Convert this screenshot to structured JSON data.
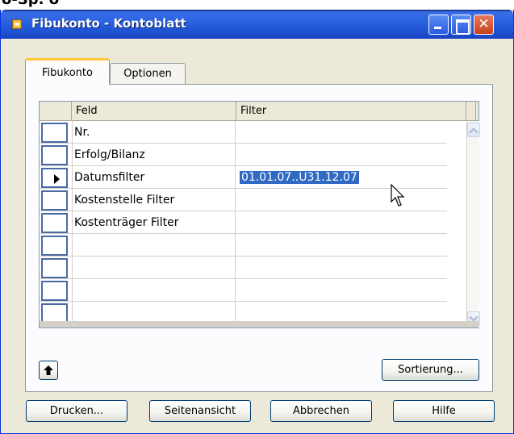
{
  "top_stub": "ö-Sp. ö",
  "window": {
    "title": "Fibukonto - Kontoblatt"
  },
  "tabs": [
    {
      "label": "Fibukonto",
      "active": true
    },
    {
      "label": "Optionen",
      "active": false
    }
  ],
  "grid": {
    "columns": [
      "Feld",
      "Filter"
    ],
    "rows": [
      {
        "feld": "Nr.",
        "filter": ""
      },
      {
        "feld": "Erfolg/Bilanz",
        "filter": ""
      },
      {
        "feld": "Datumsfilter",
        "filter": "01.01.07..U31.12.07",
        "current": true
      },
      {
        "feld": "Kostenstelle Filter",
        "filter": ""
      },
      {
        "feld": "Kostenträger Filter",
        "filter": ""
      },
      {
        "feld": "",
        "filter": ""
      },
      {
        "feld": "",
        "filter": ""
      },
      {
        "feld": "",
        "filter": ""
      },
      {
        "feld": "",
        "filter": ""
      }
    ]
  },
  "buttons": {
    "sort": "Sortierung...",
    "print": "Drucken...",
    "preview": "Seitenansicht",
    "cancel": "Abbrechen",
    "help": "Hilfe"
  },
  "colors": {
    "titlebar": "#2a63e0",
    "selection": "#316ac5",
    "tab_highlight": "#ffc83c"
  }
}
